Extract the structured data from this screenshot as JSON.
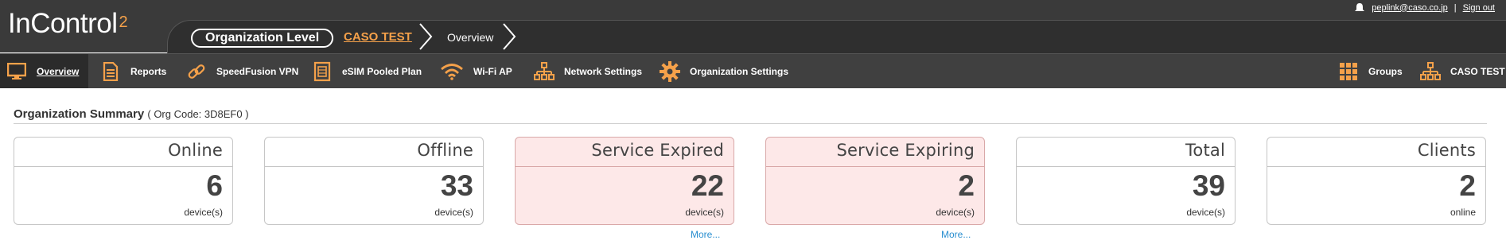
{
  "header": {
    "logo_text": "InControl",
    "logo_sup": "2",
    "breadcrumb": {
      "level": "Organization Level",
      "org": "CASO TEST",
      "page": "Overview"
    },
    "user_email": "peplink@caso.co.jp",
    "separator": "|",
    "sign_out": "Sign out"
  },
  "nav": {
    "items": [
      {
        "label": "Overview",
        "icon": "monitor-icon"
      },
      {
        "label": "Reports",
        "icon": "document-icon"
      },
      {
        "label": "SpeedFusion VPN",
        "icon": "link-icon"
      },
      {
        "label": "eSIM Pooled Plan",
        "icon": "sim-card-icon"
      },
      {
        "label": "Wi-Fi AP",
        "icon": "wifi-icon"
      },
      {
        "label": "Network Settings",
        "icon": "network-icon"
      },
      {
        "label": "Organization Settings",
        "icon": "gear-icon"
      }
    ],
    "right_items": [
      {
        "label": "Groups",
        "icon": "grid-icon"
      },
      {
        "label": "CASO TEST",
        "icon": "network-icon"
      }
    ],
    "accent": "#f5a14a"
  },
  "summary": {
    "title": "Organization Summary",
    "org_code_prefix": "( Org Code: ",
    "org_code": "3D8EF0",
    "org_code_suffix": " )",
    "cards": [
      {
        "title": "Online",
        "value": "6",
        "unit": "device(s)"
      },
      {
        "title": "Offline",
        "value": "33",
        "unit": "device(s)"
      },
      {
        "title": "Service Expired",
        "value": "22",
        "unit": "device(s)",
        "more": "More..."
      },
      {
        "title": "Service Expiring",
        "value": "2",
        "unit": "device(s)",
        "more": "More..."
      },
      {
        "title": "Total",
        "value": "39",
        "unit": "device(s)"
      },
      {
        "title": "Clients",
        "value": "2",
        "unit": "online"
      }
    ],
    "warn_bg": "#fde8e8",
    "link_color": "#2a8fd0"
  }
}
